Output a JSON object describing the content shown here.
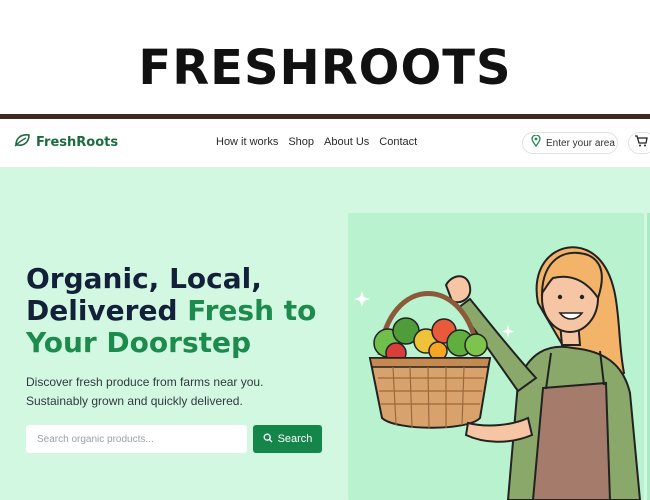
{
  "banner": {
    "title": "FRESHROOTS"
  },
  "navbar": {
    "brand": "FreshRoots",
    "links": [
      "How it works",
      "Shop",
      "About Us",
      "Contact"
    ],
    "area_label": "Enter your area"
  },
  "hero": {
    "headline_line1": "Organic, Local,",
    "headline_line2_dark": "Delivered ",
    "headline_line2_green": "Fresh to",
    "headline_line3_green": "Your Doorstep",
    "subtext_line1": "Discover fresh produce from farms near you.",
    "subtext_line2": "Sustainably grown and quickly delivered.",
    "search_placeholder": "Search organic products...",
    "search_button": "Search"
  },
  "colors": {
    "brand_green": "#1d6b40",
    "accent_green": "#1d8a4e",
    "button_green": "#15864a",
    "hero_bg": "#d3f8e2",
    "divider_brown": "#3f2a23"
  },
  "icons": [
    "leaf-icon",
    "location-pin-icon",
    "cart-icon",
    "search-icon",
    "sparkle-icon"
  ]
}
